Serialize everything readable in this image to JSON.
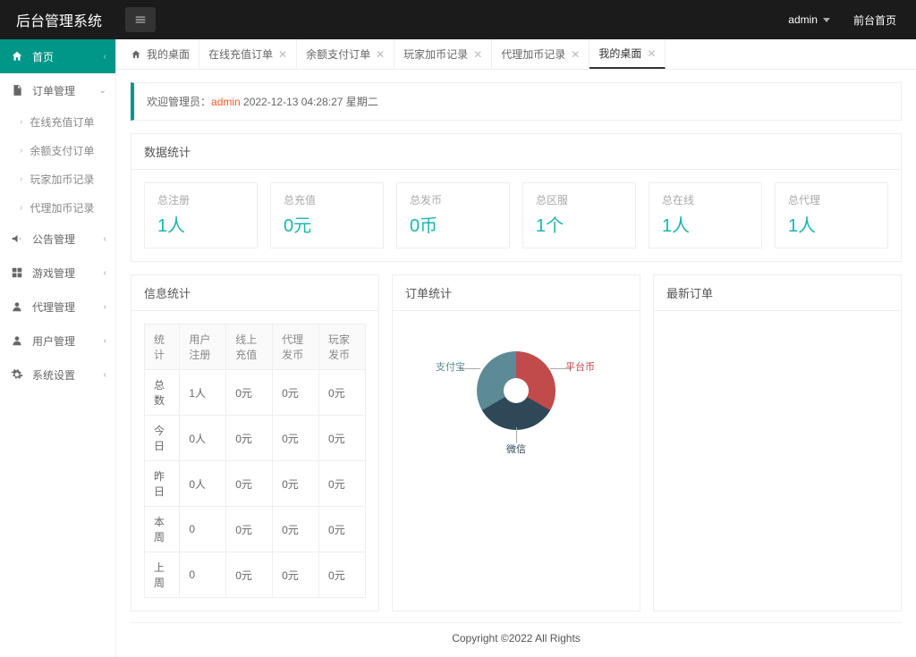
{
  "brand": "后台管理系统",
  "topbar": {
    "user": "admin",
    "front_link": "前台首页"
  },
  "sidebar": [
    {
      "label": "首页",
      "icon": "home",
      "active": true,
      "arrow": "left"
    },
    {
      "label": "订单管理",
      "icon": "doc",
      "arrow": "down",
      "children": [
        {
          "label": "在线充值订单"
        },
        {
          "label": "余额支付订单"
        },
        {
          "label": "玩家加币记录"
        },
        {
          "label": "代理加币记录"
        }
      ]
    },
    {
      "label": "公告管理",
      "icon": "horn",
      "arrow": "left"
    },
    {
      "label": "游戏管理",
      "icon": "grid",
      "arrow": "left"
    },
    {
      "label": "代理管理",
      "icon": "user",
      "arrow": "left"
    },
    {
      "label": "用户管理",
      "icon": "user",
      "arrow": "left"
    },
    {
      "label": "系统设置",
      "icon": "gear",
      "arrow": "left"
    }
  ],
  "tabs": [
    {
      "label": "我的桌面",
      "home": true,
      "closable": false
    },
    {
      "label": "在线充值订单",
      "closable": true
    },
    {
      "label": "余额支付订单",
      "closable": true
    },
    {
      "label": "玩家加币记录",
      "closable": true
    },
    {
      "label": "代理加币记录",
      "closable": true
    },
    {
      "label": "我的桌面",
      "closable": true,
      "active": true
    }
  ],
  "welcome": {
    "prefix": "欢迎管理员：",
    "admin": "admin",
    "datetime": " 2022-12-13  04:28:27  星期二"
  },
  "data_stats": {
    "title": "数据统计",
    "cards": [
      {
        "label": "总注册",
        "value": "1人"
      },
      {
        "label": "总充值",
        "value": "0元"
      },
      {
        "label": "总发币",
        "value": "0币"
      },
      {
        "label": "总区服",
        "value": "1个"
      },
      {
        "label": "总在线",
        "value": "1人"
      },
      {
        "label": "总代理",
        "value": "1人"
      }
    ]
  },
  "info_stats": {
    "title": "信息统计",
    "headers": [
      "统计",
      "用户注册",
      "线上充值",
      "代理发币",
      "玩家发币"
    ],
    "rows": [
      [
        "总数",
        "1人",
        "0元",
        "0元",
        "0元"
      ],
      [
        "今日",
        "0人",
        "0元",
        "0元",
        "0元"
      ],
      [
        "昨日",
        "0人",
        "0元",
        "0元",
        "0元"
      ],
      [
        "本周",
        "0",
        "0元",
        "0元",
        "0元"
      ],
      [
        "上周",
        "0",
        "0元",
        "0元",
        "0元"
      ]
    ]
  },
  "order_stats": {
    "title": "订单统计"
  },
  "latest_orders": {
    "title": "最新订单"
  },
  "chart_data": {
    "type": "pie",
    "title": "订单统计",
    "series": [
      {
        "name": "支付宝",
        "value": 1,
        "color": "#5C8B96"
      },
      {
        "name": "平台币",
        "value": 1,
        "color": "#C14A4A"
      },
      {
        "name": "微信",
        "value": 1,
        "color": "#2F4858"
      }
    ]
  },
  "footer": "Copyright ©2022 All Rights"
}
